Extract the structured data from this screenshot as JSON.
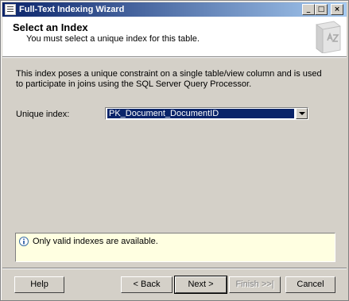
{
  "window": {
    "title": "Full-Text Indexing Wizard"
  },
  "header": {
    "title": "Select an Index",
    "subtitle": "You must select a unique index for this table."
  },
  "description": "This index poses a unique constraint on a single table/view column and is used to participate in joins using the SQL Server Query Processor.",
  "unique_index": {
    "label": "Unique index:",
    "value": "PK_Document_DocumentID"
  },
  "message": "Only valid indexes are available.",
  "buttons": {
    "help": "Help",
    "back": "< Back",
    "next": "Next >",
    "finish": "Finish >>|",
    "cancel": "Cancel"
  },
  "colors": {
    "titlebar_start": "#0a246a",
    "titlebar_end": "#a6caf0",
    "selection": "#0a246a",
    "info_background": "#ffffe1",
    "face": "#d4d0c8"
  },
  "icons": {
    "app": "document-icon",
    "header": "book-az-icon",
    "info": "info-icon",
    "combo": "chevron-down-icon"
  }
}
